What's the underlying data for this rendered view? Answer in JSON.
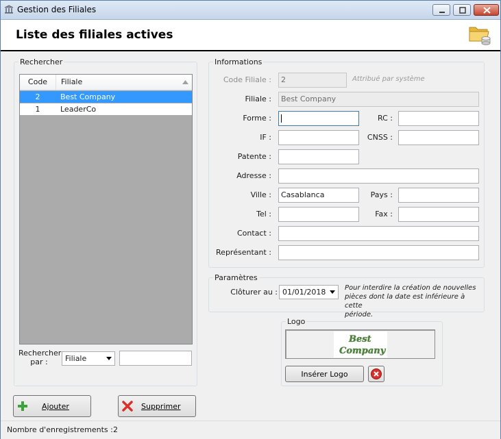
{
  "window": {
    "title": "Gestion des Filiales"
  },
  "header": {
    "title": "Liste des filiales actives"
  },
  "search_panel": {
    "group_label": "Rechercher",
    "grid": {
      "columns": [
        "Code",
        "Filiale"
      ],
      "rows": [
        {
          "code": "2",
          "filiale": "Best Company",
          "selected": true
        },
        {
          "code": "1",
          "filiale": "LeaderCo",
          "selected": false
        }
      ]
    },
    "search_by_label_line1": "Rechercher",
    "search_by_label_line2": "par :",
    "search_by_value": "Filiale",
    "search_value": ""
  },
  "info": {
    "group_label": "Informations",
    "code_label": "Code Filiale :",
    "code_value": "2",
    "code_hint": "Attribué par système",
    "filiale_label": "Filiale :",
    "filiale_value": "Best Company",
    "forme_label": "Forme :",
    "forme_value": "",
    "rc_label": "RC :",
    "rc_value": "",
    "if_label": "IF :",
    "if_value": "",
    "cnss_label": "CNSS :",
    "cnss_value": "",
    "patente_label": "Patente :",
    "patente_value": "",
    "adresse_label": "Adresse :",
    "adresse_value": "",
    "ville_label": "Ville :",
    "ville_value": "Casablanca",
    "pays_label": "Pays :",
    "pays_value": "",
    "tel_label": "Tel :",
    "tel_value": "",
    "fax_label": "Fax :",
    "fax_value": "",
    "contact_label": "Contact :",
    "contact_value": "",
    "representant_label": "Représentant :",
    "representant_value": ""
  },
  "params": {
    "group_label": "Paramètres",
    "cloturer_label": "Clôturer au :",
    "cloturer_value": "01/01/2018",
    "note_line1": "Pour interdire la création de nouvelles",
    "note_line2": "pièces dont la date est inférieure à cette",
    "note_line3": "période."
  },
  "logo": {
    "group_label": "Logo",
    "logo_line1": "Best",
    "logo_line2": "Company",
    "insert_label": "Insérer Logo"
  },
  "actions": {
    "add_label": "Ajouter",
    "delete_label": "Supprimer"
  },
  "status": {
    "label": "Nombre d'enregistrements :",
    "count": "2"
  },
  "icons": {
    "app": "building-icon",
    "folder": "folder-database-icon",
    "add": "plus-icon",
    "delete": "x-icon",
    "remove_logo": "delete-circle-icon"
  },
  "colors": {
    "selection": "#3399ff",
    "add_icon": "#3aa43a",
    "delete_icon": "#d9302a"
  }
}
